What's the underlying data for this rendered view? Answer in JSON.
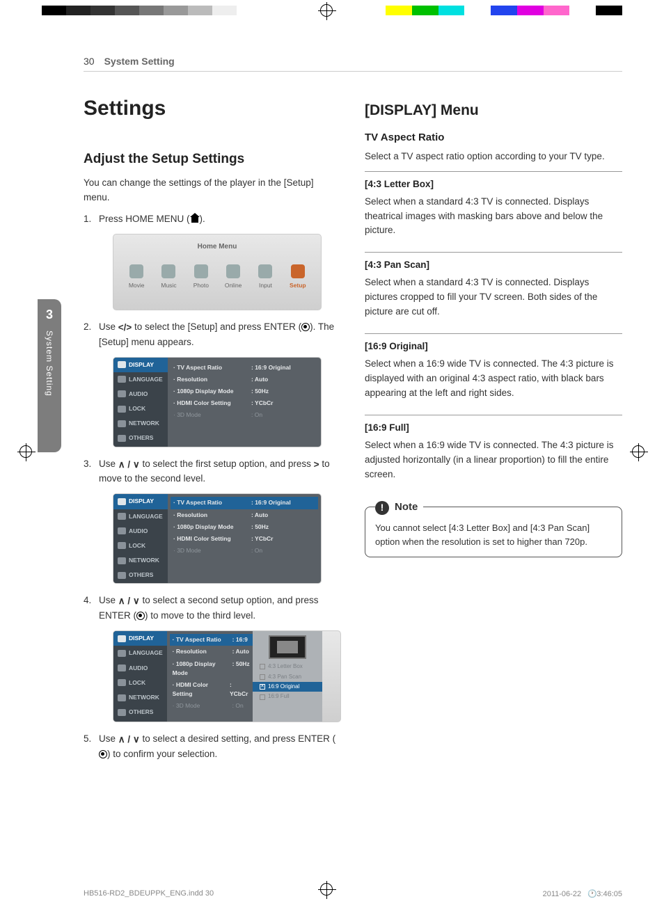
{
  "page": {
    "number": "30",
    "section": "System Setting"
  },
  "sidetab": {
    "number": "3",
    "label": "System Setting"
  },
  "left": {
    "h1": "Settings",
    "h2": "Adjust the Setup Settings",
    "intro": "You can change the settings of the player in the [Setup] menu.",
    "steps": {
      "s1a": "Press HOME MENU (",
      "s1b": ").",
      "s2a": "Use ",
      "s2nav": "</>",
      "s2b": " to select the [Setup] and press ENTER (",
      "s2c": "). The [Setup] menu appears.",
      "s3a": "Use ",
      "s3nav": "∧ / ∨",
      "s3b": " to select the first setup option, and press ",
      "s3nav2": ">",
      "s3c": " to move to the second level.",
      "s4a": "Use ",
      "s4nav": "∧ / ∨",
      "s4b": " to select a second setup option, and press ENTER (",
      "s4c": ") to move to the third level.",
      "s5a": "Use ",
      "s5nav": "∧ / ∨",
      "s5b": " to select a desired setting, and press ENTER (",
      "s5c": ") to confirm your selection."
    },
    "home_menu": {
      "title": "Home Menu",
      "items": [
        "Movie",
        "Music",
        "Photo",
        "Online",
        "Input",
        "Setup"
      ],
      "selected_index": 5
    },
    "setup_menu": {
      "side": [
        "DISPLAY",
        "LANGUAGE",
        "AUDIO",
        "LOCK",
        "NETWORK",
        "OTHERS"
      ],
      "rows": [
        {
          "label": "TV Aspect Ratio",
          "value": "16:9 Original"
        },
        {
          "label": "Resolution",
          "value": "Auto"
        },
        {
          "label": "1080p Display Mode",
          "value": "50Hz"
        },
        {
          "label": "HDMI Color Setting",
          "value": "YCbCr"
        },
        {
          "label": "3D Mode",
          "value": "On",
          "dim": true
        }
      ]
    },
    "third_menu": {
      "rows": [
        {
          "label": "TV Aspect Ratio",
          "value": "16:9"
        },
        {
          "label": "Resolution",
          "value": "Auto"
        },
        {
          "label": "1080p Display Mode",
          "value": "50Hz"
        },
        {
          "label": "HDMI Color Setting",
          "value": "YCbCr"
        },
        {
          "label": "3D Mode",
          "value": "On",
          "dim": true
        }
      ],
      "options": [
        "4:3 Letter Box",
        "4:3 Pan Scan",
        "16:9 Original",
        "16:9 Full"
      ],
      "selected_option_index": 2
    }
  },
  "right": {
    "h2": "[DISPLAY] Menu",
    "h3": "TV Aspect Ratio",
    "intro": "Select a TV aspect ratio option according to your TV type.",
    "opts": [
      {
        "title": "[4:3 Letter Box]",
        "body": "Select when a standard 4:3 TV is connected. Displays theatrical images with masking bars above and below the picture."
      },
      {
        "title": "[4:3 Pan Scan]",
        "body": "Select when a standard 4:3 TV is connected. Displays pictures cropped to fill your TV screen. Both sides of the picture are cut off."
      },
      {
        "title": "[16:9 Original]",
        "body": "Select when a 16:9 wide TV is connected. The 4:3 picture is displayed with an original 4:3 aspect ratio, with black bars appearing at the left and right sides."
      },
      {
        "title": "[16:9 Full]",
        "body": "Select when a 16:9 wide TV is connected. The 4:3 picture is adjusted horizontally (in a linear proportion) to fill the entire screen."
      }
    ],
    "note_label": "Note",
    "note_body": "You cannot select [4:3 Letter Box] and [4:3 Pan Scan] option when the resolution is set to higher than 720p."
  },
  "footer": {
    "file": "HB516-RD2_BDEUPPK_ENG.indd   30",
    "date": "2011-06-22",
    "time": "3:46:05"
  }
}
